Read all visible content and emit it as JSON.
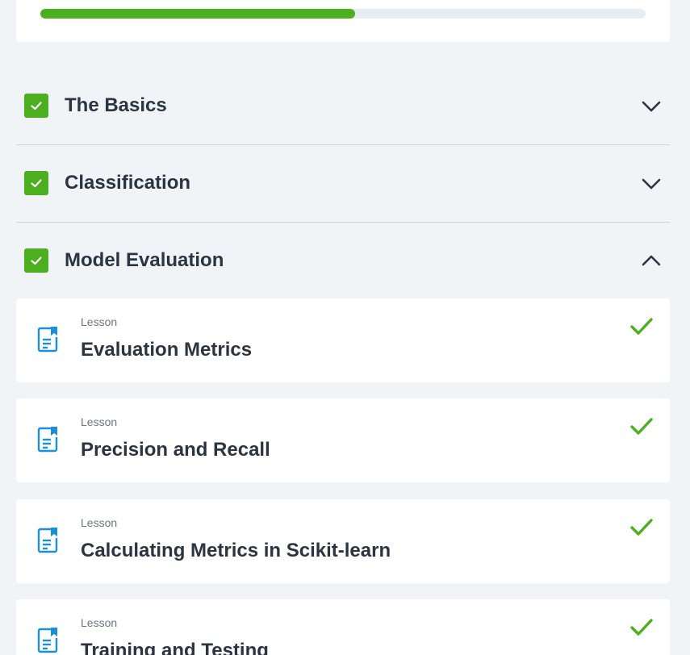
{
  "progress": {
    "percent": 52
  },
  "colors": {
    "accent": "#4caf1f",
    "icon": "#1a8fdc",
    "text": "#2b3440"
  },
  "sections": [
    {
      "title": "The Basics",
      "completed": true,
      "expanded": false
    },
    {
      "title": "Classification",
      "completed": true,
      "expanded": false
    },
    {
      "title": "Model Evaluation",
      "completed": true,
      "expanded": true
    }
  ],
  "lessons": [
    {
      "type": "Lesson",
      "title": "Evaluation Metrics",
      "completed": true,
      "icon": "lesson-document-icon"
    },
    {
      "type": "Lesson",
      "title": "Precision and Recall",
      "completed": true,
      "icon": "lesson-document-icon"
    },
    {
      "type": "Lesson",
      "title": "Calculating Metrics in Scikit-learn",
      "completed": true,
      "icon": "lesson-document-icon"
    },
    {
      "type": "Lesson",
      "title": "Training and Testing",
      "completed": true,
      "icon": "lesson-document-icon"
    }
  ]
}
